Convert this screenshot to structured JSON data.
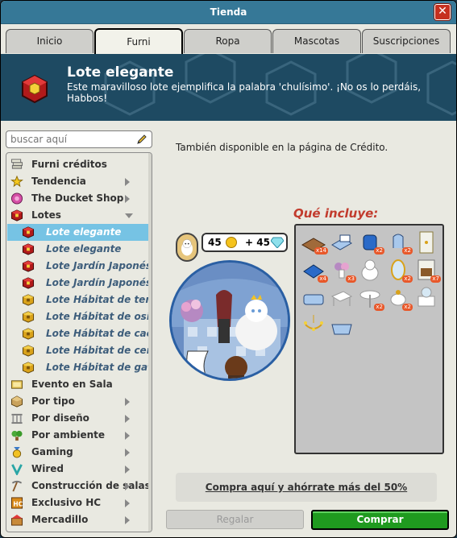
{
  "window": {
    "title": "Tienda",
    "close_label": "✕"
  },
  "tabs": [
    {
      "label": "Inicio"
    },
    {
      "label": "Furni",
      "active": true
    },
    {
      "label": "Ropa"
    },
    {
      "label": "Mascotas"
    },
    {
      "label": "Suscripciones"
    }
  ],
  "header": {
    "title": "Lote elegante",
    "subtitle": "Este maravilloso lote ejemplifica la palabra 'chulísimo'. ¡No os lo perdáis, Habbos!",
    "icon": "red-cube-icon"
  },
  "search": {
    "placeholder": "buscar aquí",
    "value": ""
  },
  "sidebar": {
    "items": [
      {
        "label": "Furni créditos",
        "icon": "coins-stack-icon",
        "arrow": "none"
      },
      {
        "label": "Tendencia",
        "icon": "star-icon",
        "arrow": "right"
      },
      {
        "label": "The Ducket Shop",
        "icon": "ducket-icon",
        "arrow": "right"
      },
      {
        "label": "Lotes",
        "icon": "red-cube-icon",
        "arrow": "down"
      },
      {
        "label": "Lote elegante",
        "icon": "red-cube-icon",
        "sub": true,
        "selected": true
      },
      {
        "label": "Lote elegante",
        "icon": "red-cube-icon",
        "sub": true
      },
      {
        "label": "Lote Jardín Japonés",
        "icon": "red-cube-icon",
        "sub": true
      },
      {
        "label": "Lote Jardín Japonés",
        "icon": "red-cube-icon",
        "sub": true
      },
      {
        "label": "Lote Hábitat de terriers",
        "icon": "gold-cube-icon",
        "sub": true
      },
      {
        "label": "Lote Hábitat de osito pa",
        "icon": "gold-cube-icon",
        "sub": true
      },
      {
        "label": "Lote Hábitat de cachorr",
        "icon": "gold-cube-icon",
        "sub": true
      },
      {
        "label": "Lote Hábitat de cerditos",
        "icon": "gold-cube-icon",
        "sub": true
      },
      {
        "label": "Lote Hábitat de gatitos",
        "icon": "gold-cube-icon",
        "sub": true
      },
      {
        "label": "Evento en Sala",
        "icon": "event-icon",
        "arrow": "none"
      },
      {
        "label": "Por tipo",
        "icon": "box-icon",
        "arrow": "right"
      },
      {
        "label": "Por diseño",
        "icon": "columns-icon",
        "arrow": "right"
      },
      {
        "label": "Por ambiente",
        "icon": "plant-icon",
        "arrow": "right"
      },
      {
        "label": "Gaming",
        "icon": "medal-icon",
        "arrow": "right"
      },
      {
        "label": "Wired",
        "icon": "wired-icon",
        "arrow": "right"
      },
      {
        "label": "Construcción de salas",
        "icon": "pickaxe-icon",
        "arrow": "right"
      },
      {
        "label": "Exclusivo HC",
        "icon": "hc-icon",
        "arrow": "right"
      },
      {
        "label": "Mercadillo",
        "icon": "market-icon",
        "arrow": "right"
      }
    ]
  },
  "content": {
    "info": "También disponible en la página de Crédito.",
    "price": {
      "credits": "45",
      "diamonds": "+ 45"
    },
    "includes_title": "Qué incluye:",
    "items": [
      {
        "icon": "wood-planks-icon",
        "count": "x14"
      },
      {
        "icon": "blue-bed-icon",
        "count": ""
      },
      {
        "icon": "blue-armchair-icon",
        "count": "x2"
      },
      {
        "icon": "blue-chair-icon",
        "count": "x2"
      },
      {
        "icon": "wardrobe-icon",
        "count": ""
      },
      {
        "icon": "blue-rug-icon",
        "count": "x4"
      },
      {
        "icon": "flowers-icon",
        "count": "x3"
      },
      {
        "icon": "white-cat-icon",
        "count": ""
      },
      {
        "icon": "mirror-icon",
        "count": "x2"
      },
      {
        "icon": "wall-panel-icon",
        "count": "x7"
      },
      {
        "icon": "blue-sofa-icon",
        "count": ""
      },
      {
        "icon": "white-table-icon",
        "count": ""
      },
      {
        "icon": "round-table-icon",
        "count": "x2"
      },
      {
        "icon": "teapot-icon",
        "count": "x2"
      },
      {
        "icon": "vanity-icon",
        "count": ""
      },
      {
        "icon": "chandelier-icon",
        "count": ""
      },
      {
        "icon": "bathtub-icon",
        "count": ""
      }
    ],
    "promo": "Compra aquí y ahórrate más del 50%",
    "gift_label": "Regalar",
    "buy_label": "Comprar"
  },
  "colors": {
    "titlebar": "#367897",
    "header_bg": "#1e4a62",
    "selected_item": "#76c3e4",
    "buy_button": "#1f9a1f",
    "includes_title": "#c23b2d"
  }
}
